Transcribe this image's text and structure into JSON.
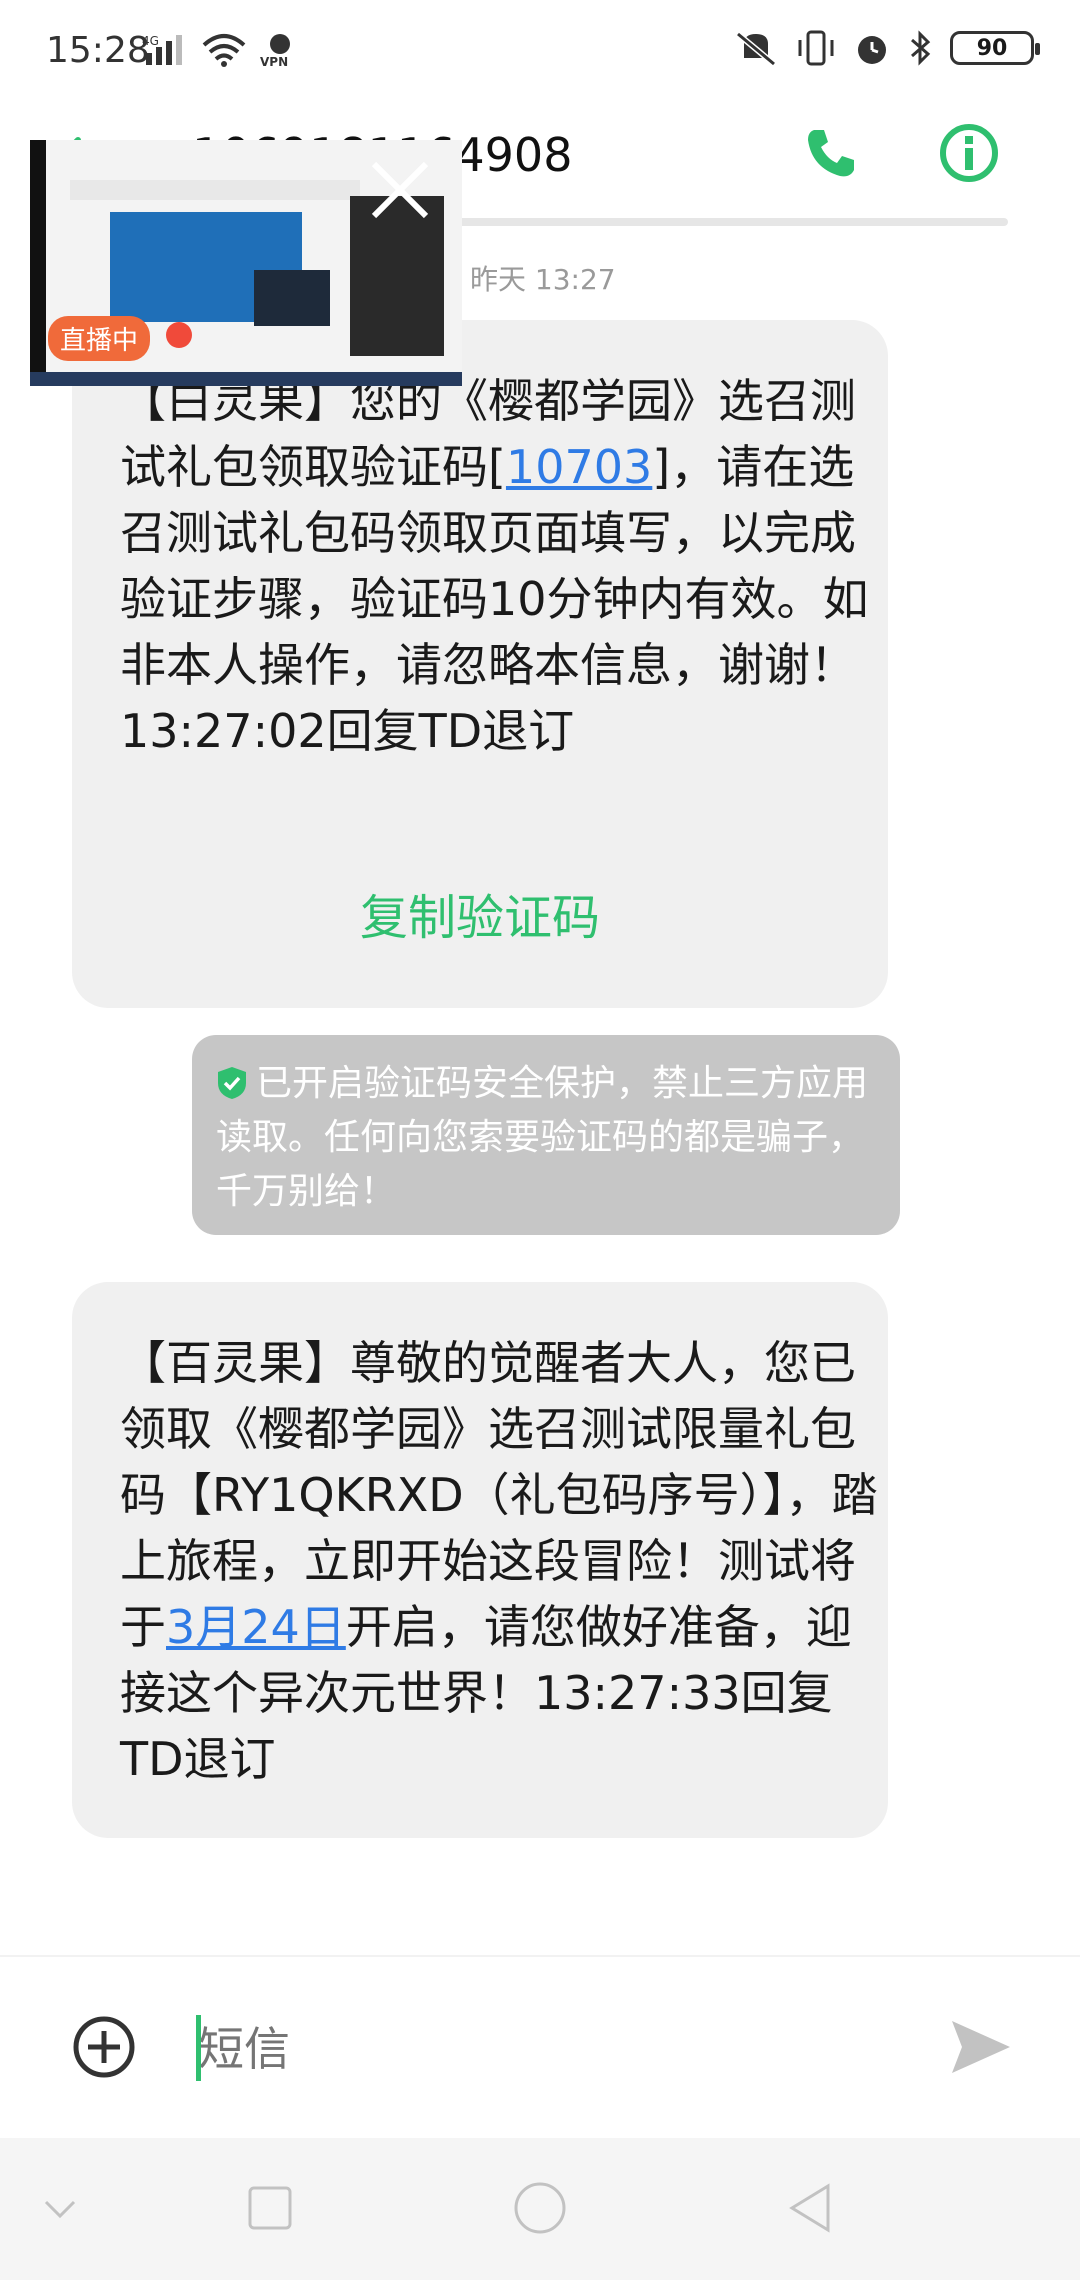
{
  "status_bar": {
    "time": "15:28",
    "network": "4G",
    "vpn": "VPN",
    "battery": "90"
  },
  "header": {
    "phone_number": "1069181164908"
  },
  "date_label": "昨天 13:27",
  "messages": [
    {
      "parts": [
        "【白灵果】您的《樱都学园》选召测试礼包领取验证码[",
        "10703",
        "]，请在选召测试礼包码领取页面填写，以完成验证步骤，验证码10分钟内有效。如非本人操作，请忽略本信息，谢谢！13:27:02回复TD退订"
      ],
      "copy_button": "复制验证码"
    },
    {
      "parts": [
        "【百灵果】尊敬的觉醒者大人，您已领取《樱都学园》选召测试限量礼包码【RY1QKRXD（礼包码序号）】，踏上旅程，立即开始这段冒险！测试将于",
        "3月24日",
        "开启，请您做好准备，迎接这个异次元世界！13:27:33回复TD退订"
      ]
    }
  ],
  "security_notice": "已开启验证码安全保护，禁止三方应用读取。任何向您索要验证码的都是骗子，千万别给！",
  "live_overlay": {
    "badge": "直播中"
  },
  "input": {
    "placeholder": "短信"
  },
  "colors": {
    "accent_green": "#2fbf6f",
    "link_blue": "#2f7be5",
    "bubble_bg": "#f0f0f0",
    "notice_bg": "#c6c6c6"
  },
  "icons": {
    "call": "phone-icon",
    "info": "info-icon",
    "add": "plus-circle-icon",
    "send": "send-icon",
    "shield": "shield-check-icon"
  }
}
